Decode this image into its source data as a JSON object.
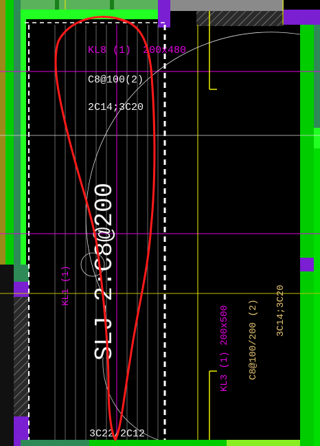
{
  "colors": {
    "background": "#000000",
    "wall_green": "#00cc00",
    "wall_green_dark": "#2e8b57",
    "wall_green_bright": "#22ff22",
    "column_purple": "#7a1fd1",
    "hatch_gray": "#8a8a8a",
    "axis_yellow": "#f0f000",
    "annotation_magenta": "#e000e0",
    "annotation_tan": "#e0c070",
    "annotation_white": "#f2f2f2",
    "markup_red": "#ff1a1a",
    "olive": "#9a8a1a"
  },
  "annotations": {
    "kl8_name": "KL8 (1)",
    "kl8_size": "200x480",
    "kl8_stirrup": "C8@100(2)",
    "kl8_main": "2C14;3C20",
    "slab_rebar": "SLJ-2:C8@200",
    "kl1_name": "KL1 (1)",
    "kl3_name_size": "KL3 (1)  200x500",
    "kl3_stirrup": "C8@100/200 (2)",
    "kl3_main": "3C14;3C20",
    "bottom_rebar": "3C22/2C12"
  },
  "icons": {
    "markup": "red-freehand-loop"
  }
}
